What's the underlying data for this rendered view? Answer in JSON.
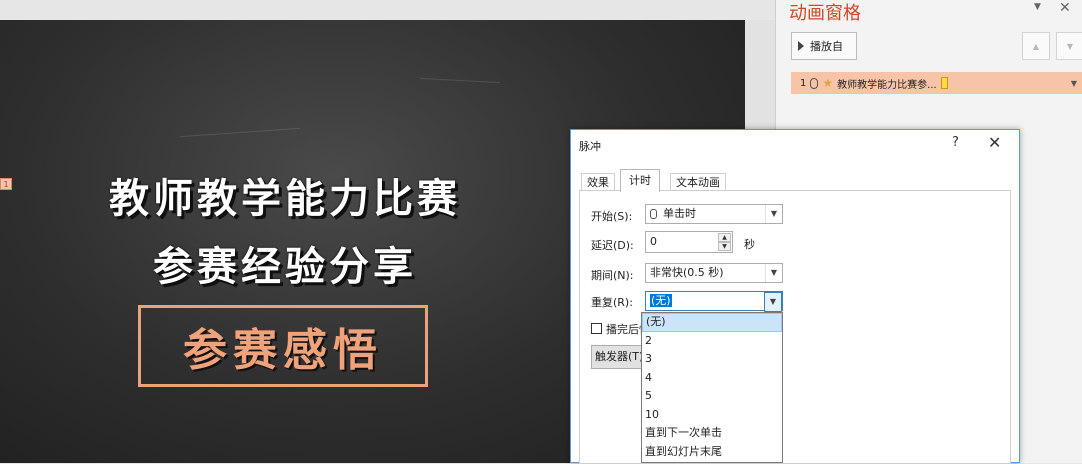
{
  "slide": {
    "title_line1": "教师教学能力比赛",
    "title_line2": "参赛经验分享",
    "subtitle": "参赛感悟",
    "anim_tag": "1",
    "accent_color": "#f0a27a"
  },
  "animation_pane": {
    "title": "动画窗格",
    "play_label": "播放自",
    "items": [
      {
        "index": "1",
        "label": "教师教学能力比赛参..."
      }
    ]
  },
  "dialog": {
    "title": "脉冲",
    "help": "?",
    "close": "✕",
    "tabs": [
      "效果",
      "计时",
      "文本动画"
    ],
    "active_tab": "计时",
    "fields": {
      "start_label": "开始(S):",
      "start_value": "单击时",
      "delay_label": "延迟(D):",
      "delay_value": "0",
      "delay_unit": "秒",
      "duration_label": "期间(N):",
      "duration_value": "非常快(0.5 秒)",
      "repeat_label": "重复(R):",
      "repeat_value": "(无)"
    },
    "rewind_checkbox_label": "播完后快退",
    "trigger_button": "触发器(T)",
    "repeat_options": [
      "(无)",
      "2",
      "3",
      "4",
      "5",
      "10",
      "直到下一次单击",
      "直到幻灯片末尾"
    ],
    "selected_option_index": 0
  }
}
